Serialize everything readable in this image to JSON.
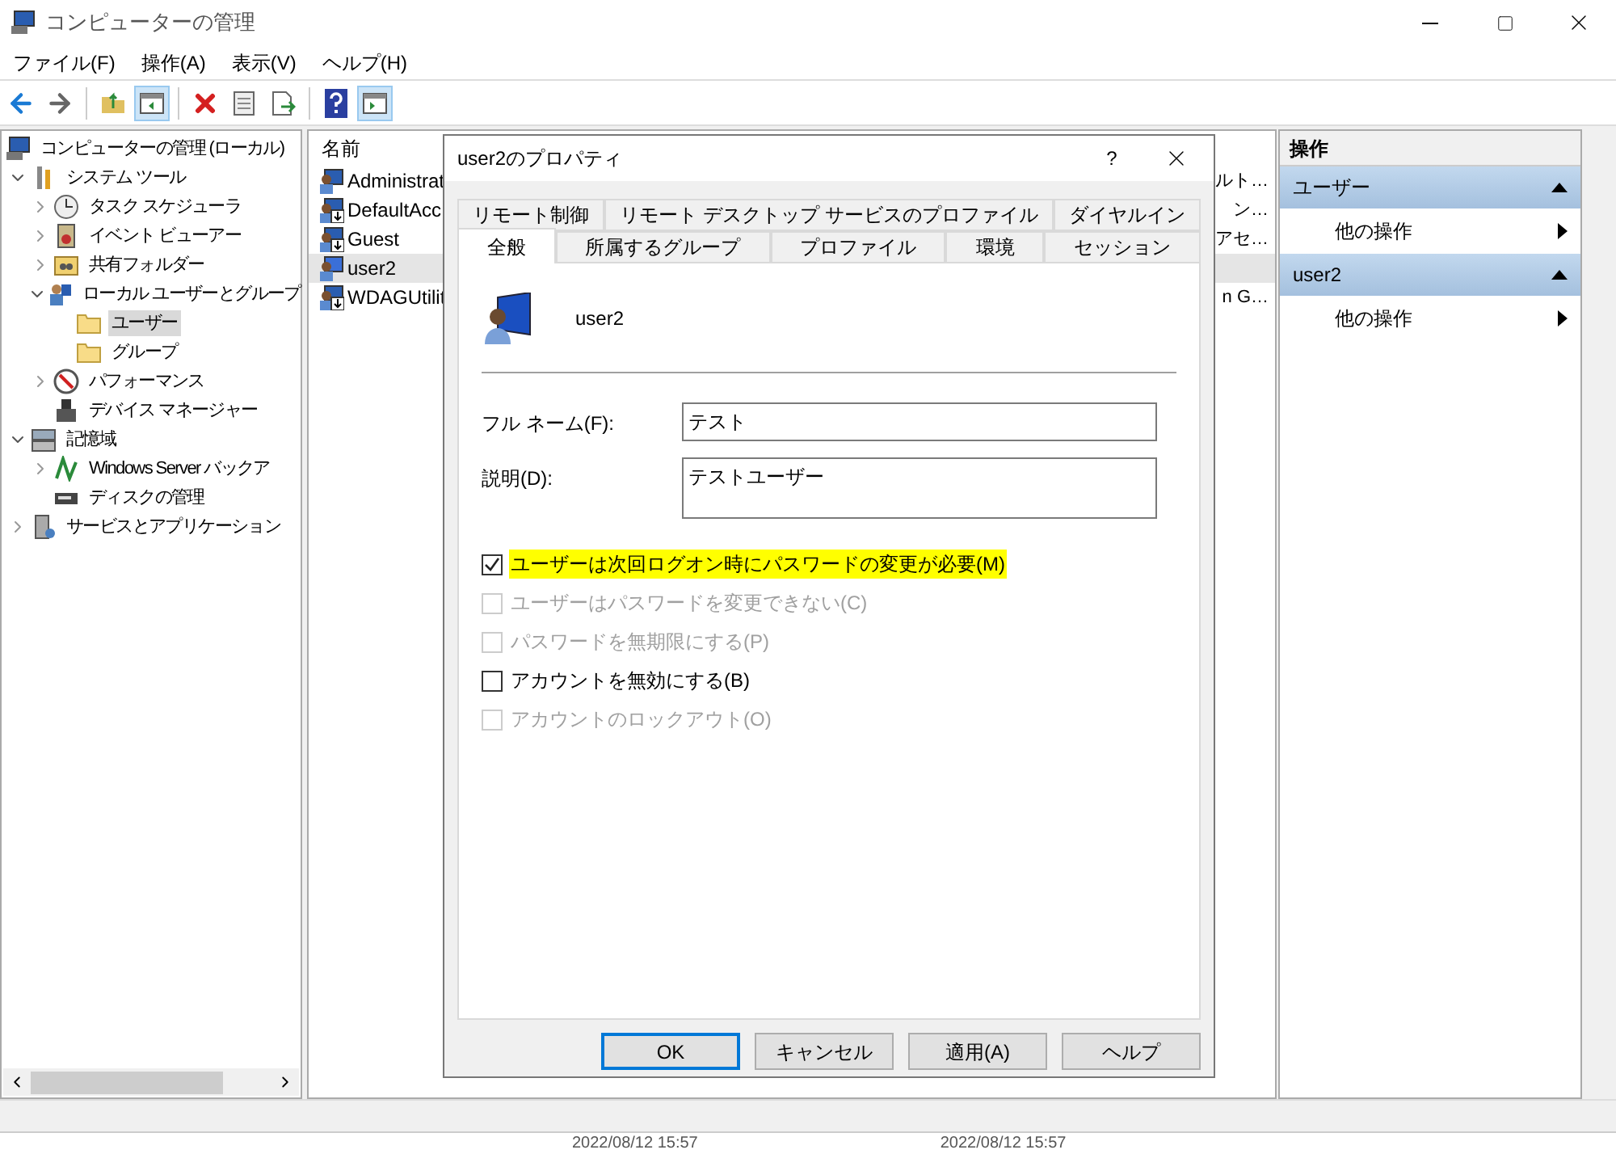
{
  "window": {
    "title": "コンピューターの管理"
  },
  "menu": [
    "ファイル(F)",
    "操作(A)",
    "表示(V)",
    "ヘルプ(H)"
  ],
  "toolbar": [
    {
      "kind": "back"
    },
    {
      "kind": "forward"
    },
    {
      "kind": "separator"
    },
    {
      "kind": "up"
    },
    {
      "kind": "tree-toggle",
      "on": true
    },
    {
      "kind": "separator"
    },
    {
      "kind": "delete"
    },
    {
      "kind": "properties"
    },
    {
      "kind": "export"
    },
    {
      "kind": "separator"
    },
    {
      "kind": "help"
    },
    {
      "kind": "pane-toggle",
      "on": true
    }
  ],
  "tree": [
    {
      "label": "コンピューターの管理 (ローカル)",
      "selected": false,
      "children": [
        {
          "label": "システム ツール",
          "expanded": true,
          "selected": false,
          "children": [
            {
              "label": "タスク スケジューラ",
              "expanded": false,
              "selected": false
            },
            {
              "label": "イベント ビューアー",
              "expanded": false,
              "selected": false
            },
            {
              "label": "共有フォルダー",
              "expanded": false,
              "selected": false
            },
            {
              "label": "ローカル ユーザーとグループ",
              "expanded": true,
              "selected": false,
              "children": [
                {
                  "label": "ユーザー",
                  "selected": true
                },
                {
                  "label": "グループ",
                  "selected": false
                }
              ]
            },
            {
              "label": "パフォーマンス",
              "expanded": false,
              "selected": false
            },
            {
              "label": "デバイス マネージャー",
              "selected": false
            }
          ]
        },
        {
          "label": "記憶域",
          "expanded": true,
          "selected": false,
          "children": [
            {
              "label": "Windows Server バックア",
              "expanded": false,
              "selected": false
            },
            {
              "label": "ディスクの管理",
              "selected": false
            }
          ]
        },
        {
          "label": "サービスとアプリケーション",
          "expanded": false,
          "selected": false
        }
      ]
    }
  ],
  "list": {
    "columns": [
      "名前"
    ],
    "rows": [
      {
        "name": "Administrat",
        "column_2": "ルト…",
        "selected": false,
        "disabled": false
      },
      {
        "name": "DefaultAcc",
        "column_2": "ン…",
        "selected": false,
        "disabled": true
      },
      {
        "name": "Guest",
        "column_2": "アセ…",
        "selected": false,
        "disabled": true
      },
      {
        "name": "user2",
        "selected": true,
        "disabled": false
      },
      {
        "name": "WDAGUtilit",
        "column_2": "n G…",
        "selected": false,
        "disabled": true
      }
    ]
  },
  "actions": {
    "title": "操作",
    "sections": [
      {
        "title": "ユーザー",
        "expanded": true,
        "items": [
          "他の操作"
        ]
      },
      {
        "title": "user2",
        "expanded": true,
        "items": [
          "他の操作"
        ]
      }
    ]
  },
  "bottom_strip": [
    "2022/08/12 15:57",
    "2022/08/12 15:57"
  ],
  "dialog": {
    "title": "user2のプロパティ",
    "help": "?",
    "tab_rows": [
      [
        {
          "label": "リモート制御",
          "selected": false
        },
        {
          "label": "リモート デスクトップ サービスのプロファイル",
          "selected": false
        },
        {
          "label": "ダイヤルイン",
          "selected": false
        }
      ],
      [
        {
          "label": "全般",
          "selected": true
        },
        {
          "label": "所属するグループ",
          "selected": false
        },
        {
          "label": "プロファイル",
          "selected": false
        },
        {
          "label": "環境",
          "selected": false
        },
        {
          "label": "セッション",
          "selected": false
        }
      ]
    ],
    "user_name": "user2",
    "fields": [
      {
        "label": "フル ネーム(F):",
        "value": "テスト",
        "kind": "line"
      },
      {
        "label": "説明(D):",
        "value": "テストユーザー",
        "kind": "area"
      }
    ],
    "checkboxes": [
      {
        "label": "ユーザーは次回ログオン時にパスワードの変更が必要(M)",
        "checked": true,
        "disabled": false,
        "highlighted": true
      },
      {
        "label": "ユーザーはパスワードを変更できない(C)",
        "checked": false,
        "disabled": true,
        "highlighted": false
      },
      {
        "label": "パスワードを無期限にする(P)",
        "checked": false,
        "disabled": true,
        "highlighted": false
      },
      {
        "label": "アカウントを無効にする(B)",
        "checked": false,
        "disabled": false,
        "highlighted": false
      },
      {
        "label": "アカウントのロックアウト(O)",
        "checked": false,
        "disabled": true,
        "highlighted": false
      }
    ],
    "buttons": [
      {
        "label": "OK",
        "kind": "default"
      },
      {
        "label": "キャンセル",
        "kind": "normal"
      },
      {
        "label": "適用(A)",
        "kind": "normal"
      },
      {
        "label": "ヘルプ",
        "kind": "normal"
      }
    ]
  }
}
